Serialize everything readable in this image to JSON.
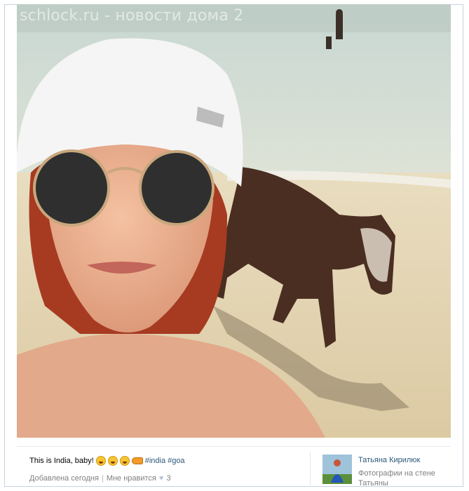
{
  "watermark": "schlock.ru - новости дома 2",
  "post": {
    "caption_text": "This is India, baby!",
    "emoji": [
      "laughing-tears-emoji",
      "laughing-tears-emoji",
      "laughing-tears-emoji",
      "tiger-emoji"
    ],
    "hashtags": [
      "#india",
      "#goa"
    ],
    "added_label": "Добавлена сегодня",
    "separator": "|",
    "like_label": "Мне нравится",
    "like_count": "3"
  },
  "author": {
    "name": "Татьяна Кирилюк",
    "subtitle": "Фотографии на стене Татьяны"
  },
  "colors": {
    "link": "#2b587a",
    "muted": "#808080",
    "border": "#c7d3df"
  }
}
